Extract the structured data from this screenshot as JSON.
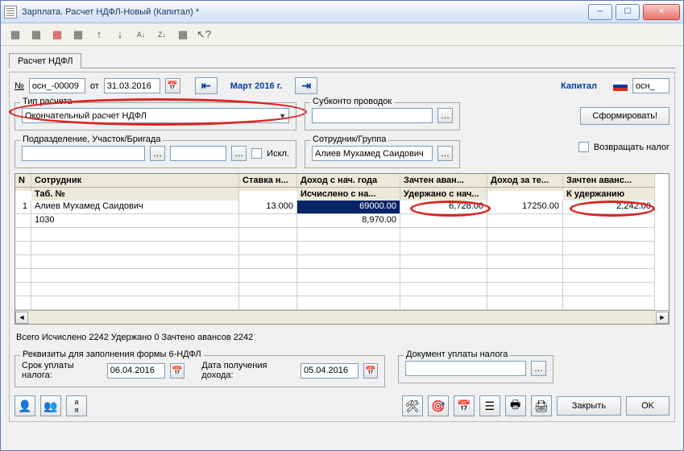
{
  "window": {
    "title": "Зарплата. Расчет НДФЛ-Новый (Капитал) *"
  },
  "tab": {
    "label": "Расчет НДФЛ"
  },
  "doc": {
    "num_label": "№",
    "number": "осн_-00009",
    "date_label": "от",
    "date": "31.03.2016",
    "period": "Март 2016 г.",
    "company": "Капитал",
    "prefix": "осн_"
  },
  "calc_type": {
    "legend": "Тип расчета",
    "value": "Окончательный расчет НДФЛ"
  },
  "subkonto": {
    "legend": "Субконто проводок"
  },
  "subdiv": {
    "legend": "Подразделение, Участок/Бригада",
    "iskl": "Искл."
  },
  "employee_filter": {
    "legend": "Сотрудник/Группа",
    "value": "Алиев Мухамед Саидович"
  },
  "generate_btn": "Сформировать!",
  "return_tax": "Возвращать налог",
  "table": {
    "headers": {
      "n": "N",
      "employee": "Сотрудник",
      "tabno": "Таб. №",
      "rate": "Ставка н...",
      "income_year": "Доход с нач. года",
      "calc_year": "Исчислено с на...",
      "advance_credited": "Зачтен аван...",
      "withheld_year": "Удержано с нач...",
      "income_period": "Доход за те...",
      "advance_credited2": "Зачтен аванс...",
      "to_withhold": "К удержанию"
    },
    "rows": [
      {
        "n": "1",
        "employee": "Алиев Мухамед Саидович",
        "tabno": "1030",
        "rate": "13.000",
        "income_year": "69000.00",
        "calc_year": "8,970.00",
        "advance_credited": "6,728.00",
        "income_period": "17250.00",
        "to_withhold": "2,242.00"
      }
    ]
  },
  "summary": "Всего  Исчислено 2242  Удержано 0  Зачтено авансов 2242",
  "form6": {
    "legend": "Реквизиты для заполнения формы 6-НДФЛ",
    "pay_date_label": "Срок уплаты налога:",
    "pay_date": "06.04.2016",
    "income_date_label": "Дата получения дохода:",
    "income_date": "05.04.2016"
  },
  "payment_doc": {
    "legend": "Документ уплаты налога"
  },
  "buttons": {
    "close": "Закрыть",
    "ok": "OK"
  },
  "chart_data": null
}
